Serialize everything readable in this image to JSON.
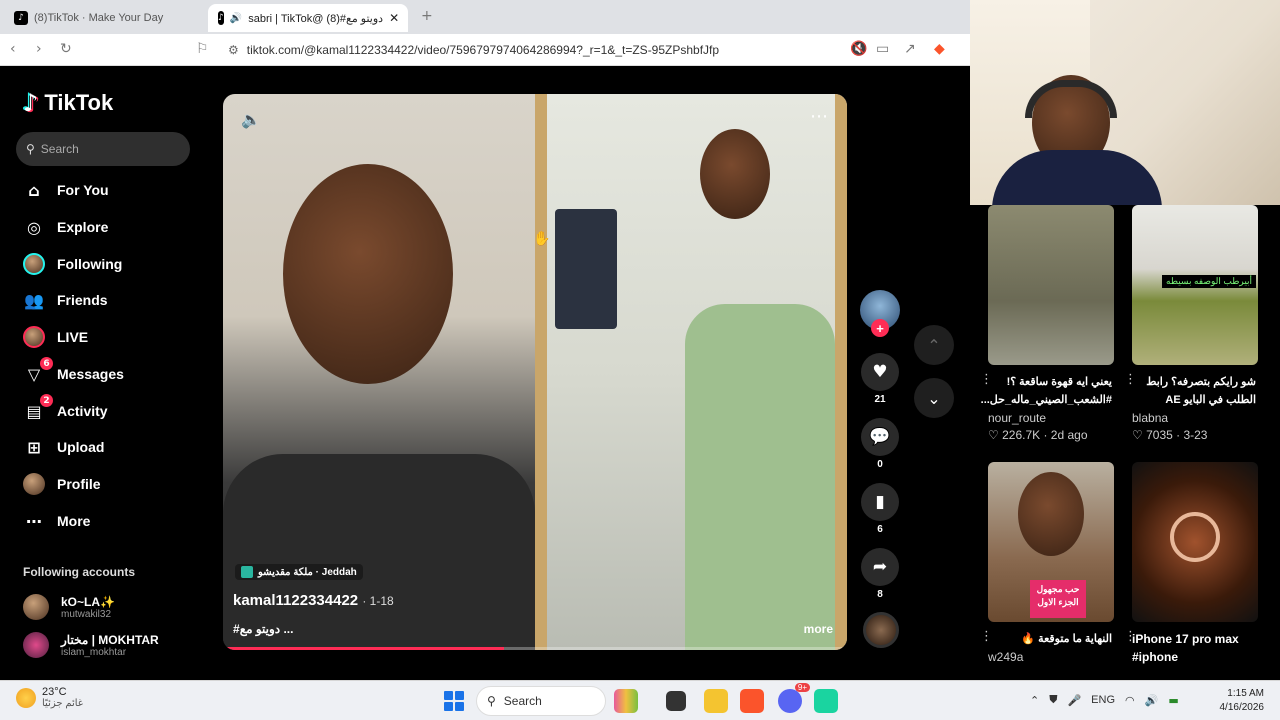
{
  "browser": {
    "tabs": [
      {
        "label": "(8)TikTok · Make Your Day",
        "active": false
      },
      {
        "label": "sabri | TikTok@ دويتو مع#(8)",
        "active": true
      }
    ],
    "url": "tiktok.com/@kamal1122334422/video/7596797974064286994?_r=1&_t=ZS-95ZPshbfJfp"
  },
  "sidebar": {
    "logo": "TikTok",
    "search_placeholder": "Search",
    "nav": [
      {
        "label": "For You",
        "icon": "home-icon"
      },
      {
        "label": "Explore",
        "icon": "compass-icon"
      },
      {
        "label": "Following",
        "icon": "following-avatar-icon"
      },
      {
        "label": "Friends",
        "icon": "friends-icon"
      },
      {
        "label": "LIVE",
        "icon": "live-icon"
      },
      {
        "label": "Messages",
        "icon": "messages-icon",
        "badge": "6"
      },
      {
        "label": "Activity",
        "icon": "activity-icon",
        "badge": "2"
      },
      {
        "label": "Upload",
        "icon": "upload-icon"
      },
      {
        "label": "Profile",
        "icon": "profile-avatar-icon"
      },
      {
        "label": "More",
        "icon": "more-dots-icon"
      }
    ],
    "following_title": "Following accounts",
    "following": [
      {
        "name": "kO~LA✨",
        "handle": "mutwakil32"
      },
      {
        "name": "مختار | MOKHTAR",
        "handle": "islam_mokhtar"
      }
    ]
  },
  "video": {
    "location": "ملكة مقديشو · Jeddah",
    "author": "kamal1122334422",
    "date": "· 1-18",
    "caption": "#دويتو مع ...",
    "more": "more",
    "progress": 0.45
  },
  "actions": {
    "likes": "21",
    "comments": "0",
    "saves": "6",
    "shares": "8"
  },
  "recommended": [
    {
      "title": "يعني ايه قهوة ساقعة ؟! #الشعب_الصيني_ماله_حل...",
      "user": "nour_route",
      "stats": "226.7K · 2d ago",
      "rtl": true
    },
    {
      "title": "شو رايكم بتصرفه؟ رابط الطلب في البايو AE",
      "user": "blabna",
      "stats": "7035 · 3-23",
      "rtl": true
    },
    {
      "title": "النهاية ما متوقعة 🔥",
      "user": "w249a",
      "stats": "",
      "rtl": true
    },
    {
      "title": "iPhone 17 pro max #iphone",
      "user": "",
      "stats": "",
      "rtl": false
    }
  ],
  "thumb_text": {
    "card2_banner": "أبيرطب الوصفه بسيطه",
    "card3_banner": "حب مجهول الجزء الاول"
  },
  "taskbar": {
    "temp": "23°C",
    "weather_desc": "غائم جزئيًا",
    "search": "Search",
    "lang": "ENG",
    "time": "1:15 AM",
    "date": "4/16/2026",
    "discord_badge": "9+"
  },
  "colors": {
    "accent": "#fe2c55",
    "teal": "#25f4ee"
  }
}
